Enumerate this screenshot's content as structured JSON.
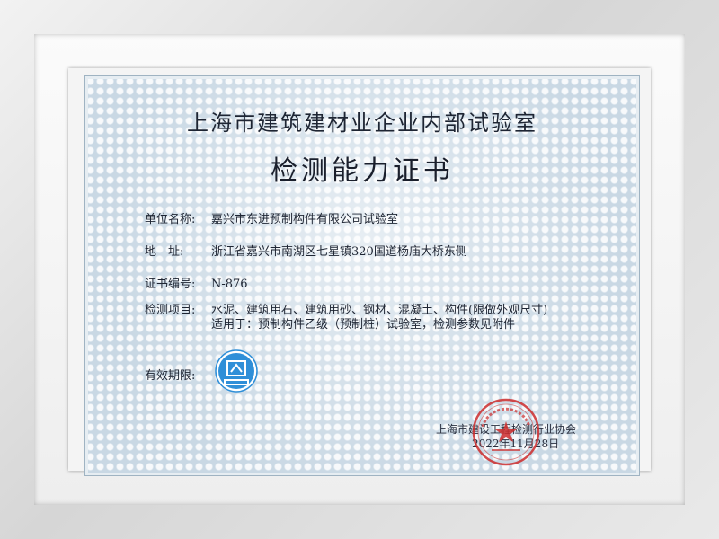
{
  "certificate": {
    "organization": "上海市建筑建材业企业内部试验室",
    "title": "检测能力证书",
    "unit_label": "单位名称:",
    "unit_value": "嘉兴市东进预制构件有限公司试验室",
    "address_label": "地　址:",
    "address_value": "浙江省嘉兴市南湖区七星镇320国道杨庙大桥东侧",
    "cert_no_label": "证书编号:",
    "cert_no_value": "N-876",
    "items_label": "检测项目:",
    "items_line1": "水泥、建筑用石、建筑用砂、钢材、混凝土、构件(限做外观尺寸)",
    "items_line2": "适用于：预制构件乙级（预制桩）试验室，检测参数见附件",
    "validity_label": "有效期限:",
    "issuer": "上海市建设工程检测行业协会",
    "issue_date": "2022年11月28日"
  },
  "colors": {
    "background": "#c9d8e4",
    "text": "#1e2533",
    "stamp_red": "#cc2b2b",
    "badge_blue": "#2f8fd8"
  },
  "icons": {
    "badge": "qualification-badge-icon",
    "seal": "official-seal-icon"
  }
}
